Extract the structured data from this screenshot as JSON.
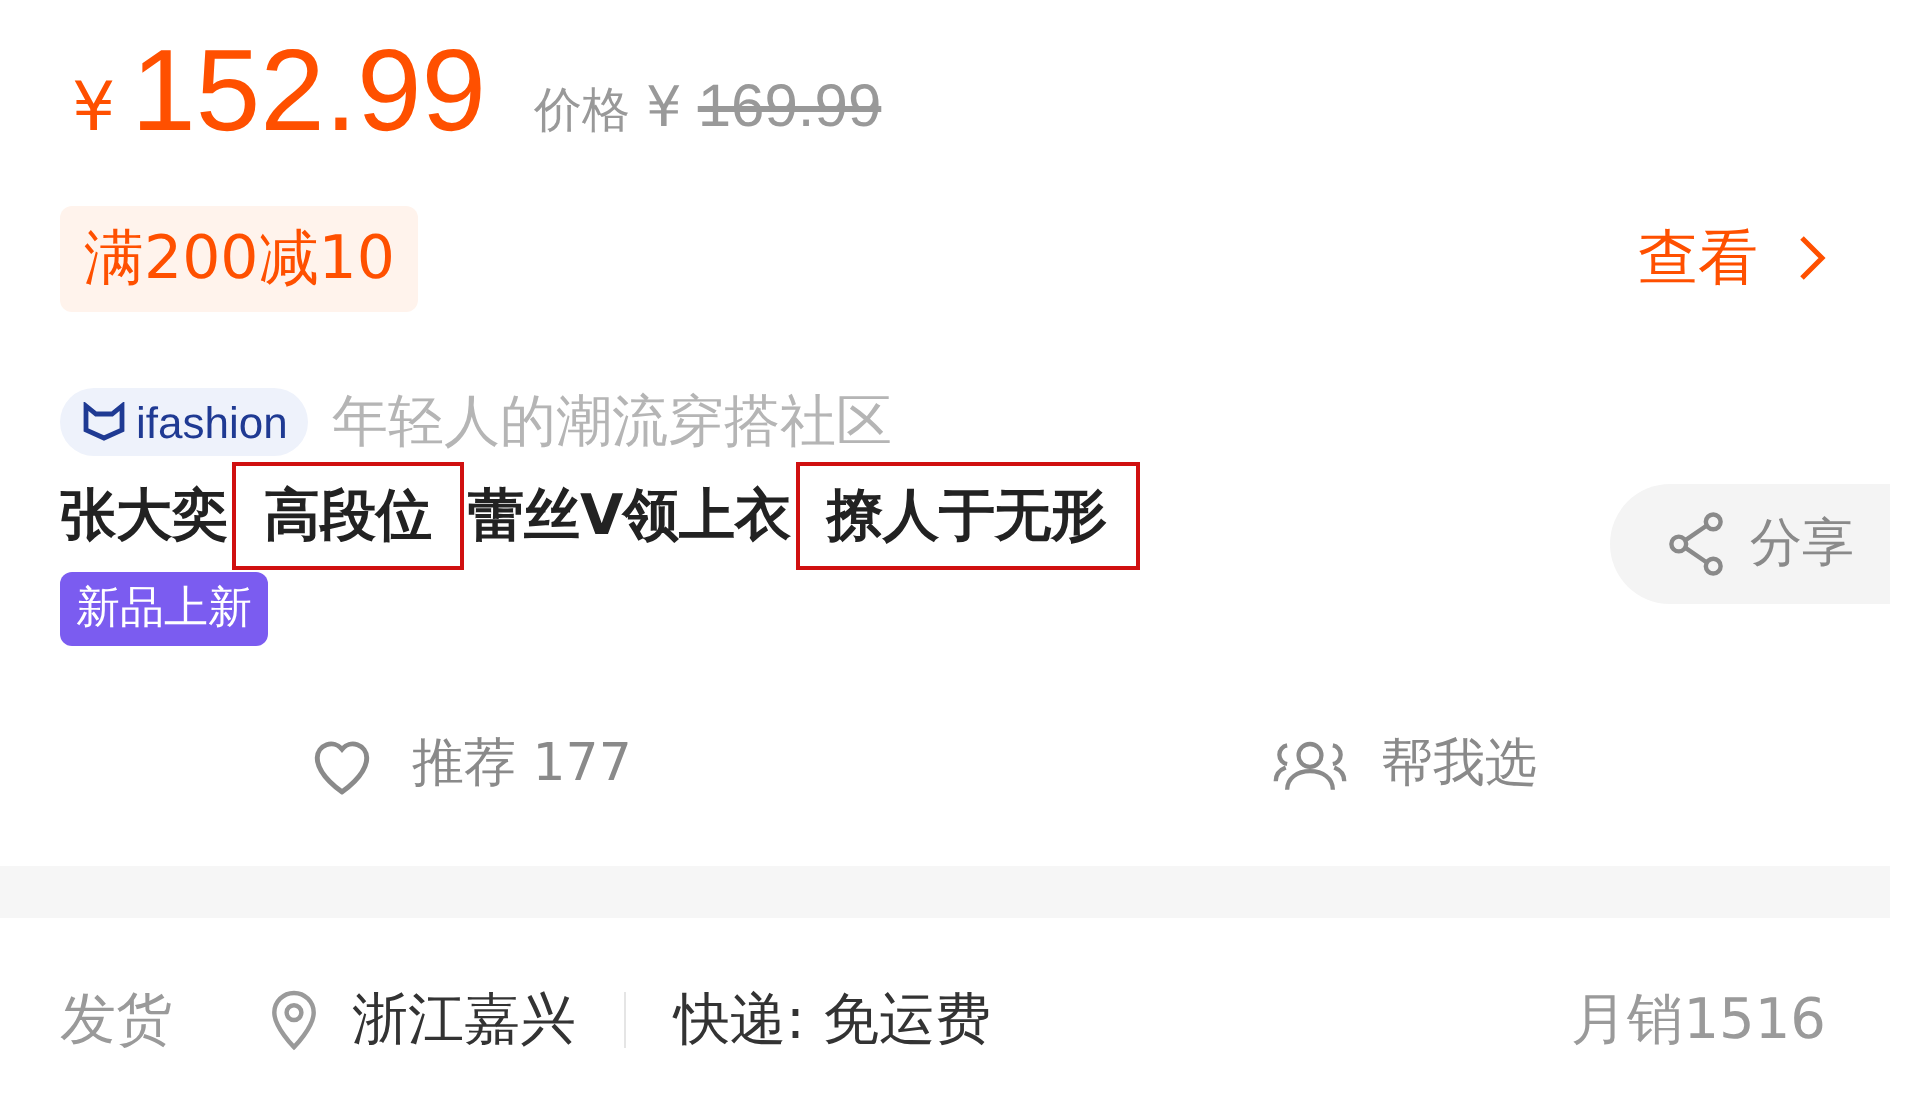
{
  "price": {
    "currency": "¥",
    "amount": "152.99",
    "original_label": "价格",
    "original_currency": "¥",
    "original_amount": "169.99"
  },
  "promo": {
    "badge": "满200减10",
    "link": "查看"
  },
  "brand": {
    "logo_text": "ifashion",
    "slogan": "年轻人的潮流穿搭社区"
  },
  "title": {
    "segments": [
      {
        "text": "张大奕",
        "highlighted": false
      },
      {
        "text": "高段位",
        "highlighted": true
      },
      {
        "text": "蕾丝V领上衣",
        "highlighted": false
      },
      {
        "text": "撩人于无形",
        "highlighted": true
      }
    ]
  },
  "tag": "新品上新",
  "share": "分享",
  "actions": [
    {
      "kind": "recommend",
      "label": "推荐 177"
    },
    {
      "kind": "help",
      "label": "帮我选"
    }
  ],
  "shipping": {
    "label": "发货",
    "location": "浙江嘉兴",
    "delivery": "快递: 免运费",
    "monthly_sales": "月销1516"
  }
}
